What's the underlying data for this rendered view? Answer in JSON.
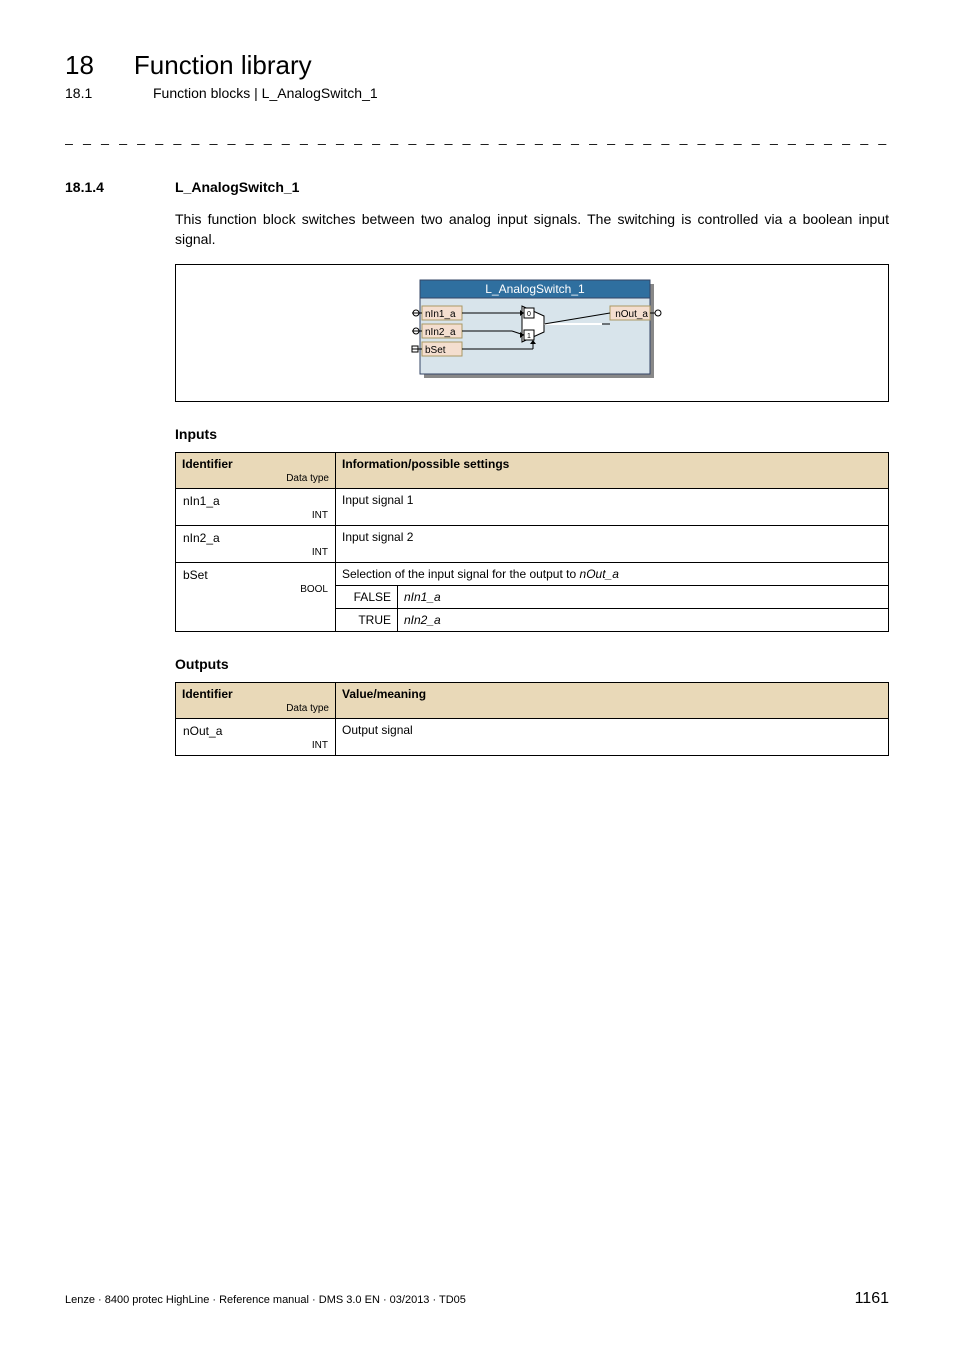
{
  "header": {
    "chapter_num": "18",
    "chapter_title": "Function library",
    "sub_num": "18.1",
    "sub_title": "Function blocks | L_AnalogSwitch_1"
  },
  "divider": "_ _ _ _ _ _ _ _ _ _ _ _ _ _ _ _ _ _ _ _ _ _ _ _ _ _ _ _ _ _ _ _ _ _ _ _ _ _ _ _ _ _ _ _ _ _ _ _ _ _ _ _ _ _ _ _ _ _ _ _ _ _ _ _",
  "section": {
    "num": "18.1.4",
    "title": "L_AnalogSwitch_1",
    "description": "This function block switches between two analog input signals. The switching is controlled via a boolean input signal."
  },
  "diagram": {
    "block_title": "L_AnalogSwitch_1",
    "in1": "nIn1_a",
    "in2": "nIn2_a",
    "bset": "bSet",
    "out": "nOut_a",
    "mux0": "0",
    "mux1": "1"
  },
  "inputs": {
    "heading": "Inputs",
    "col_id": "Identifier",
    "col_id_sub": "Data type",
    "col_info": "Information/possible settings",
    "rows": [
      {
        "id": "nIn1_a",
        "dtype": "INT",
        "info": "Input signal 1"
      },
      {
        "id": "nIn2_a",
        "dtype": "INT",
        "info": "Input signal 2"
      }
    ],
    "bset": {
      "id": "bSet",
      "dtype": "BOOL",
      "info": "Selection of the input signal for the output to",
      "info_ital": "nOut_a",
      "false_label": "FALSE",
      "false_val": "nIn1_a",
      "true_label": "TRUE",
      "true_val": "nIn2_a"
    }
  },
  "outputs": {
    "heading": "Outputs",
    "col_id": "Identifier",
    "col_id_sub": "Data type",
    "col_info": "Value/meaning",
    "rows": [
      {
        "id": "nOut_a",
        "dtype": "INT",
        "info": "Output signal"
      }
    ]
  },
  "footer": {
    "left": "Lenze · 8400 protec HighLine · Reference manual · DMS 3.0 EN · 03/2013 · TD05",
    "page": "1161"
  }
}
